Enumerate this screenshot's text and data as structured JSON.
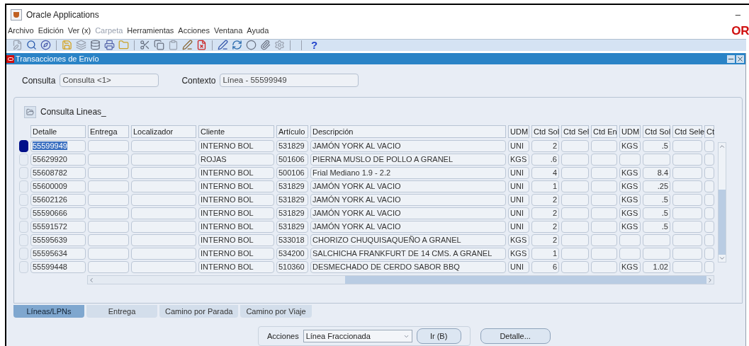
{
  "app": {
    "title": "Oracle Applications",
    "minimize": "–",
    "logo": "OR"
  },
  "menu": [
    {
      "label": "Archivo",
      "disabled": false
    },
    {
      "label": "Edición",
      "disabled": false
    },
    {
      "label": "Ver (x)",
      "disabled": false
    },
    {
      "label": "Carpeta",
      "disabled": true
    },
    {
      "label": "Herramientas",
      "disabled": false
    },
    {
      "label": "Acciones",
      "disabled": false
    },
    {
      "label": "Ventana",
      "disabled": false
    },
    {
      "label": "Ayuda",
      "disabled": false
    }
  ],
  "toolbar": {
    "help": "?"
  },
  "window": {
    "title": "Transacciones de Envío"
  },
  "query": {
    "label": "Consulta",
    "value": "Consulta <1>",
    "context_label": "Contexto",
    "context_value": "Línea - 55599949"
  },
  "section": {
    "title": "Consulta Lineas_"
  },
  "table": {
    "columns": [
      "Detalle",
      "Entrega",
      "Localizador",
      "Cliente",
      "Artículo",
      "Descripción",
      "UDM",
      "Ctd Sol",
      "Ctd Sel",
      "Ctd En",
      "UDM",
      "Ctd Sol",
      "Ctd Sele",
      "Ct"
    ],
    "rows": [
      {
        "selected": true,
        "cells": [
          "55599949",
          null,
          null,
          "INTERNO BOL",
          "531829",
          "JAMÓN YORK AL VACIO",
          "UNI",
          "2",
          null,
          null,
          "KGS",
          ".5",
          null,
          null
        ]
      },
      {
        "selected": false,
        "cells": [
          "55629920",
          null,
          null,
          "ROJAS",
          "501606",
          "PIERNA MUSLO DE POLLO A GRANEL",
          "KGS",
          ".6",
          null,
          null,
          null,
          null,
          null,
          null
        ]
      },
      {
        "selected": false,
        "cells": [
          "55608782",
          null,
          null,
          "INTERNO BOL",
          "500106",
          "Frial Mediano 1.9 - 2.2",
          "UNI",
          "4",
          null,
          null,
          "KGS",
          "8.4",
          null,
          null
        ]
      },
      {
        "selected": false,
        "cells": [
          "55600009",
          null,
          null,
          "INTERNO BOL",
          "531829",
          "JAMÓN YORK AL VACIO",
          "UNI",
          "1",
          null,
          null,
          "KGS",
          ".25",
          null,
          null
        ]
      },
      {
        "selected": false,
        "cells": [
          "55602126",
          null,
          null,
          "INTERNO BOL",
          "531829",
          "JAMÓN YORK AL VACIO",
          "UNI",
          "2",
          null,
          null,
          "KGS",
          ".5",
          null,
          null
        ]
      },
      {
        "selected": false,
        "cells": [
          "55590666",
          null,
          null,
          "INTERNO BOL",
          "531829",
          "JAMÓN YORK AL VACIO",
          "UNI",
          "2",
          null,
          null,
          "KGS",
          ".5",
          null,
          null
        ]
      },
      {
        "selected": false,
        "cells": [
          "55591572",
          null,
          null,
          "INTERNO BOL",
          "531829",
          "JAMÓN YORK AL VACIO",
          "UNI",
          "2",
          null,
          null,
          "KGS",
          ".5",
          null,
          null
        ]
      },
      {
        "selected": false,
        "cells": [
          "55595639",
          null,
          null,
          "INTERNO BOL",
          "533018",
          "CHORIZO CHUQUISAQUEÑO A GRANEL",
          "KGS",
          "2",
          null,
          null,
          null,
          null,
          null,
          null
        ]
      },
      {
        "selected": false,
        "cells": [
          "55595634",
          null,
          null,
          "INTERNO BOL",
          "534200",
          "SALCHICHA FRANKFURT DE 14 CMS. A GRANEL",
          "KGS",
          "1",
          null,
          null,
          null,
          null,
          null,
          null
        ]
      },
      {
        "selected": false,
        "cells": [
          "55599448",
          null,
          null,
          "INTERNO BOL",
          "510360",
          "DESMECHADO DE CERDO SABOR BBQ",
          "UNI",
          "6",
          null,
          null,
          "KGS",
          "1.02",
          null,
          null
        ]
      }
    ]
  },
  "tabs": [
    {
      "label": "Líneas/LPNs",
      "selected": true
    },
    {
      "label": "Entrega",
      "selected": false
    },
    {
      "label": "Camino por Parada",
      "selected": false
    },
    {
      "label": "Camino por Viaje",
      "selected": false
    }
  ],
  "actions": {
    "label": "Acciones",
    "value": "Línea Fraccionada",
    "go_button": "Ir (B)",
    "detail_button": "Detalle..."
  }
}
